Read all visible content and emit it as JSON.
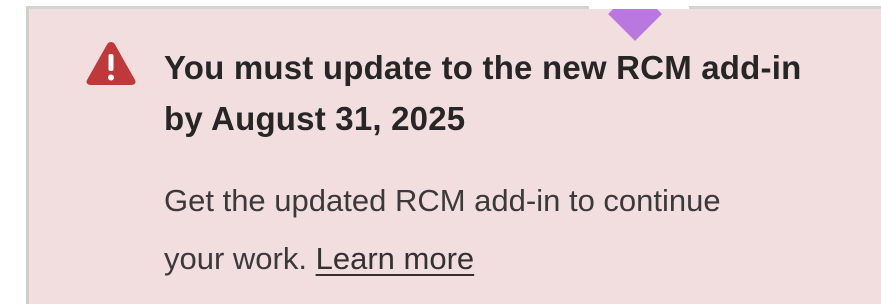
{
  "notification": {
    "title": "You must update to the new RCM add-in by August 31, 2025",
    "message": "Get the updated RCM add-in to continue your work.",
    "link_label": "Learn more",
    "icon": "warning-triangle-icon",
    "colors": {
      "background": "#f2dddf",
      "icon": "#c0393a",
      "pointer": "#b977e0",
      "title_text": "#262626",
      "body_text": "#3a3a3a"
    }
  }
}
